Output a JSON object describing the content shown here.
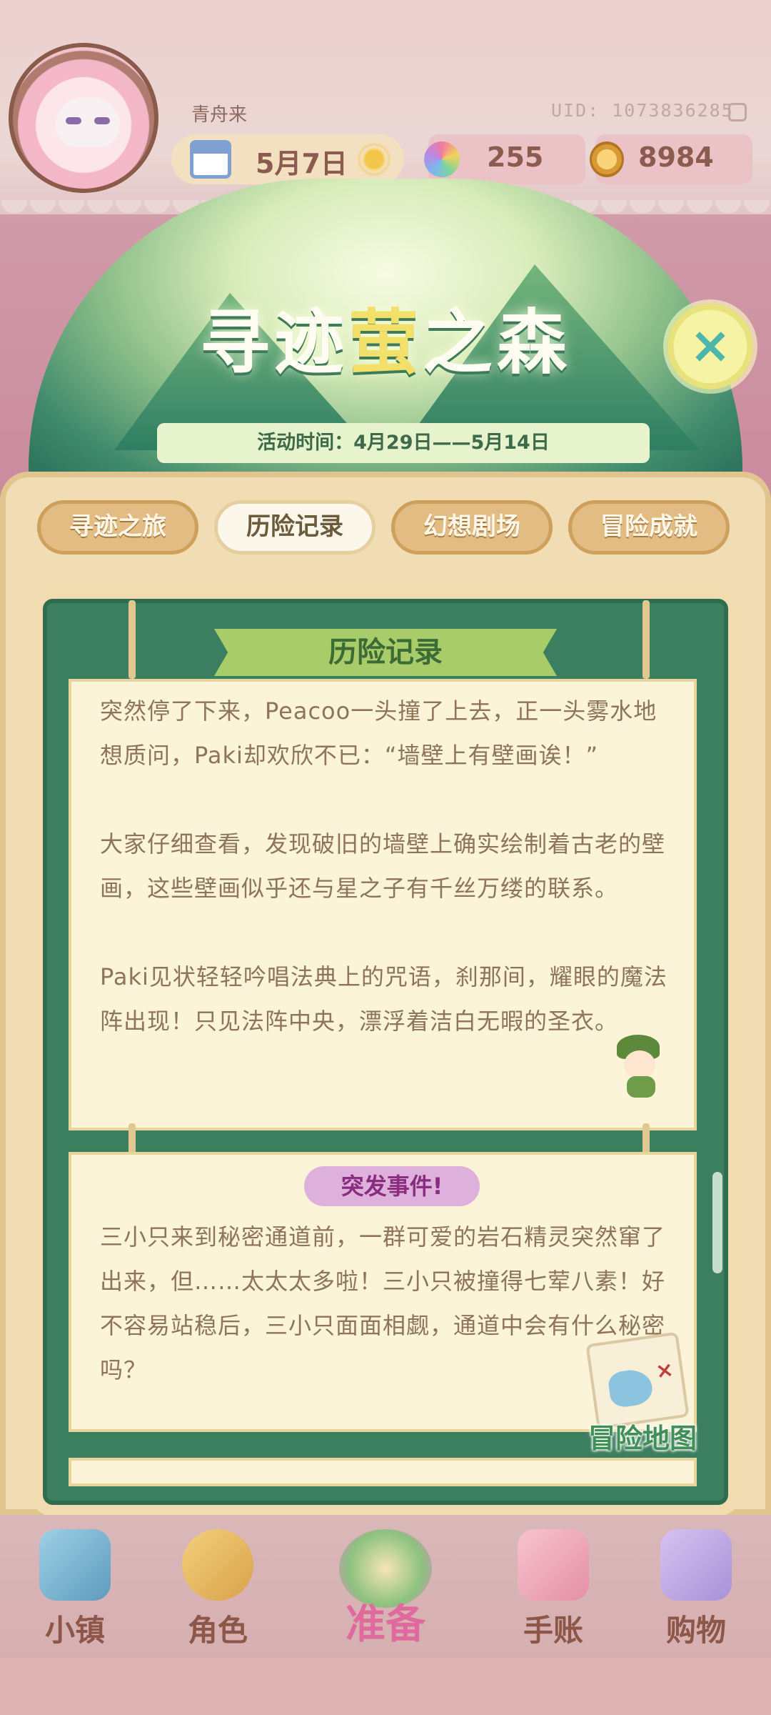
{
  "header": {
    "player_name": "青舟来",
    "uid": "UID: 1073836285",
    "date": "5月7日",
    "gems": "255",
    "coins": "8984"
  },
  "banner": {
    "title_part1": "寻迹",
    "title_highlight": "萤",
    "title_part2": "之森",
    "event_time": "活动时间：4月29日——5月14日",
    "close_icon": "×"
  },
  "tabs": [
    {
      "label": "寻迹之旅",
      "active": false
    },
    {
      "label": "历险记录",
      "active": true
    },
    {
      "label": "幻想剧场",
      "active": false
    },
    {
      "label": "冒险成就",
      "active": false
    }
  ],
  "record": {
    "title": "历险记录",
    "paragraphs": [
      "突然停了下来，Peacoo一头撞了上去，正一头雾水地想质问，Paki却欢欣不已：“墙壁上有壁画诶！”",
      "大家仔细查看，发现破旧的墙壁上确实绘制着古老的壁画，这些壁画似乎还与星之子有千丝万缕的联系。",
      "Paki见状轻轻吟唱法典上的咒语，刹那间，耀眼的魔法阵出现！只见法阵中央，漂浮着洁白无暇的圣衣。"
    ]
  },
  "event": {
    "badge": "突发事件!",
    "text": "三小只来到秘密通道前，一群可爱的岩石精灵突然窜了出来，但……太太太多啦！三小只被撞得七荤八素！好不容易站稳后，三小只面面相觑，通道中会有什么秘密吗？"
  },
  "map_button": {
    "label": "冒险地图"
  },
  "bottom_nav": [
    {
      "label": "小镇",
      "icon": "town-icon"
    },
    {
      "label": "角色",
      "icon": "character-icon"
    },
    {
      "label": "准备",
      "icon": "prepare-icon"
    },
    {
      "label": "手账",
      "icon": "journal-icon"
    },
    {
      "label": "购物",
      "icon": "shopping-icon"
    }
  ],
  "colors": {
    "accent_green": "#3c7f60",
    "tab_gold": "#e2bc83",
    "badge_purple": "#ddb1dc",
    "nav_pink": "#e0699d"
  }
}
